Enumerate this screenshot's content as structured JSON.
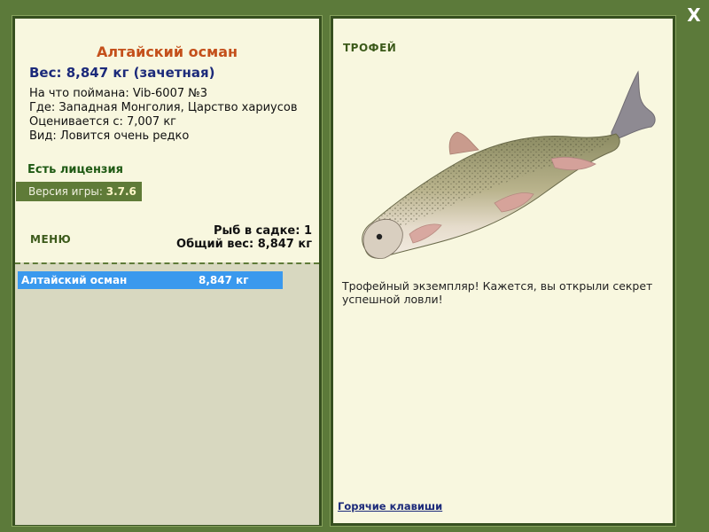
{
  "window": {
    "close_label": "X"
  },
  "fish": {
    "name": "Алтайский осман",
    "weight_label": "Вес: 8,847 кг (зачетная)",
    "bait_line": "На что поймана: Vib-6007 №3",
    "location_line": "Где: Западная Монголия, Царство хариусов",
    "rated_line": "Оценивается с: 7,007 кг",
    "species_line": "Вид: Ловится очень редко"
  },
  "license": {
    "label": "Есть лицензия"
  },
  "version": {
    "label": "Версия игры:",
    "value": "3.7.6"
  },
  "menu": {
    "label": "МЕНЮ"
  },
  "keepnet": {
    "count_line": "Рыб в садке: 1",
    "total_line": "Общий вес: 8,847 кг",
    "items": [
      {
        "name": "Алтайский осман",
        "weight": "8,847 кг"
      }
    ]
  },
  "trophy": {
    "title": "ТРОФЕЙ",
    "description": "Трофейный экземпляр! Кажется, вы открыли секрет успешной ловли!",
    "fish_image": "fish-image"
  },
  "hotkeys": {
    "label": "Горячие клавиши"
  },
  "colors": {
    "background": "#5c7a3a",
    "panel": "#f8f7df",
    "fish_name": "#c4501b",
    "weight": "#1c2a7a",
    "license": "#1f5a14",
    "list_selected": "#3a99ee"
  }
}
